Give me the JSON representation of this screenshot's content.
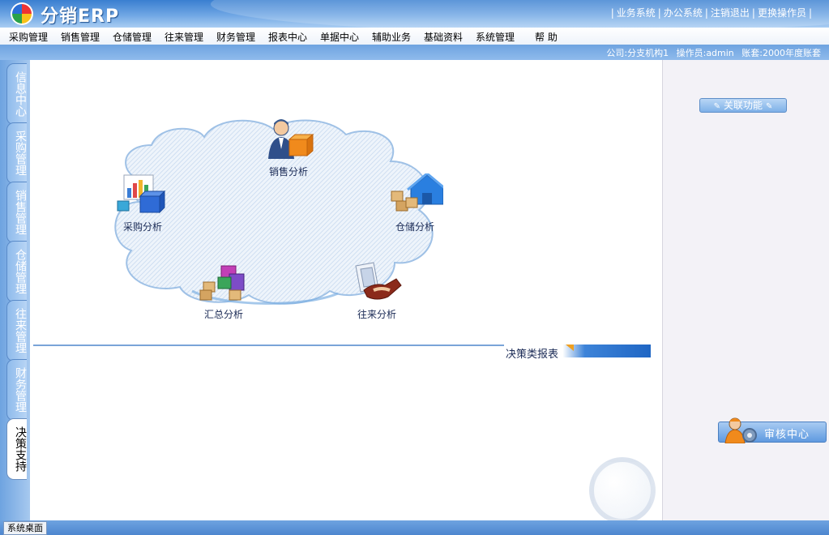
{
  "header": {
    "logo_text": "分销ERP",
    "links": [
      "业务系统",
      "办公系统",
      "注销退出",
      "更换操作员"
    ]
  },
  "menu": [
    "采购管理",
    "销售管理",
    "仓储管理",
    "往来管理",
    "财务管理",
    "报表中心",
    "单据中心",
    "辅助业务",
    "基础资料",
    "系统管理",
    "帮 助"
  ],
  "status": {
    "company": "公司:分支机构1",
    "operator": "操作员:admin",
    "account": "账套:2000年度账套"
  },
  "side_tabs": [
    "信息中心",
    "采购管理",
    "销售管理",
    "仓储管理",
    "往来管理",
    "财务管理",
    "决策支持"
  ],
  "active_tab": "决策支持",
  "diagram": {
    "sales": "销售分析",
    "purchase": "采购分析",
    "warehouse": "仓储分析",
    "summary": "汇总分析",
    "contacts": "往来分析"
  },
  "report_section": "决策类报表",
  "right_panel": {
    "related_label": "关联功能",
    "audit_label": "审核中心"
  },
  "bottom": {
    "desktop_label": "系统桌面"
  },
  "colors": {
    "header_blue": "#3a7fd0",
    "rail_blue": "#6ea3e0",
    "accent_orange": "#f0a020"
  }
}
